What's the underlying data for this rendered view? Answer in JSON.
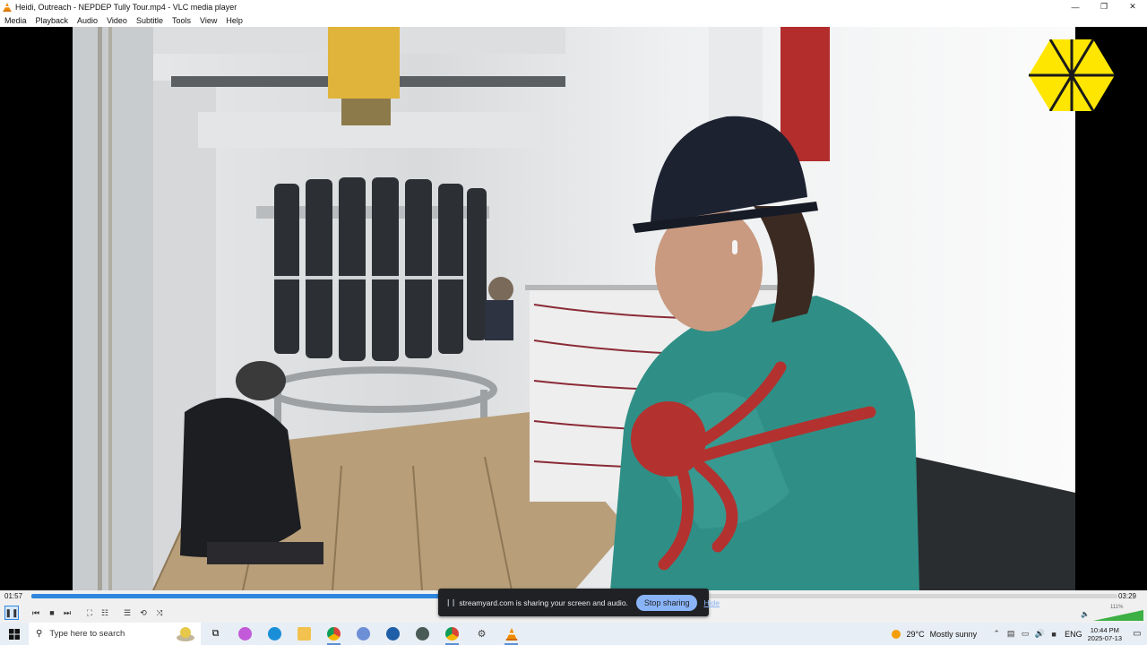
{
  "window": {
    "title": "Heidi, Outreach - NEPDEP Tully Tour.mp4 - VLC media player",
    "controls": {
      "minimize": "—",
      "restore": "❐",
      "close": "✕"
    }
  },
  "menu": [
    "Media",
    "Playback",
    "Audio",
    "Video",
    "Subtitle",
    "Tools",
    "View",
    "Help"
  ],
  "playback": {
    "elapsed": "01:57",
    "total": "03:29",
    "progress_fraction": 0.56,
    "volume_percent": "111%"
  },
  "controls_icons": [
    "play-pause-icon",
    "previous-icon",
    "stop-icon",
    "next-icon",
    "fullscreen-icon",
    "extended-settings-icon",
    "playlist-icon",
    "loop-icon",
    "shuffle-icon"
  ],
  "share_banner": {
    "message": "streamyard.com is sharing your screen and audio.",
    "stop_label": "Stop sharing",
    "hide_label": "Hide"
  },
  "taskbar": {
    "search_placeholder": "Type here to search",
    "weather_temp": "29°C",
    "weather_condition": "Mostly sunny",
    "language": "ENG",
    "time": "10:44 PM",
    "date": "2025-07-13"
  },
  "colors": {
    "vlc_orange": "#f08a00",
    "seek_blue": "#2e86de",
    "logo_yellow": "#ffe600",
    "banner_bg": "#202124",
    "banner_button": "#8ab4f8"
  }
}
